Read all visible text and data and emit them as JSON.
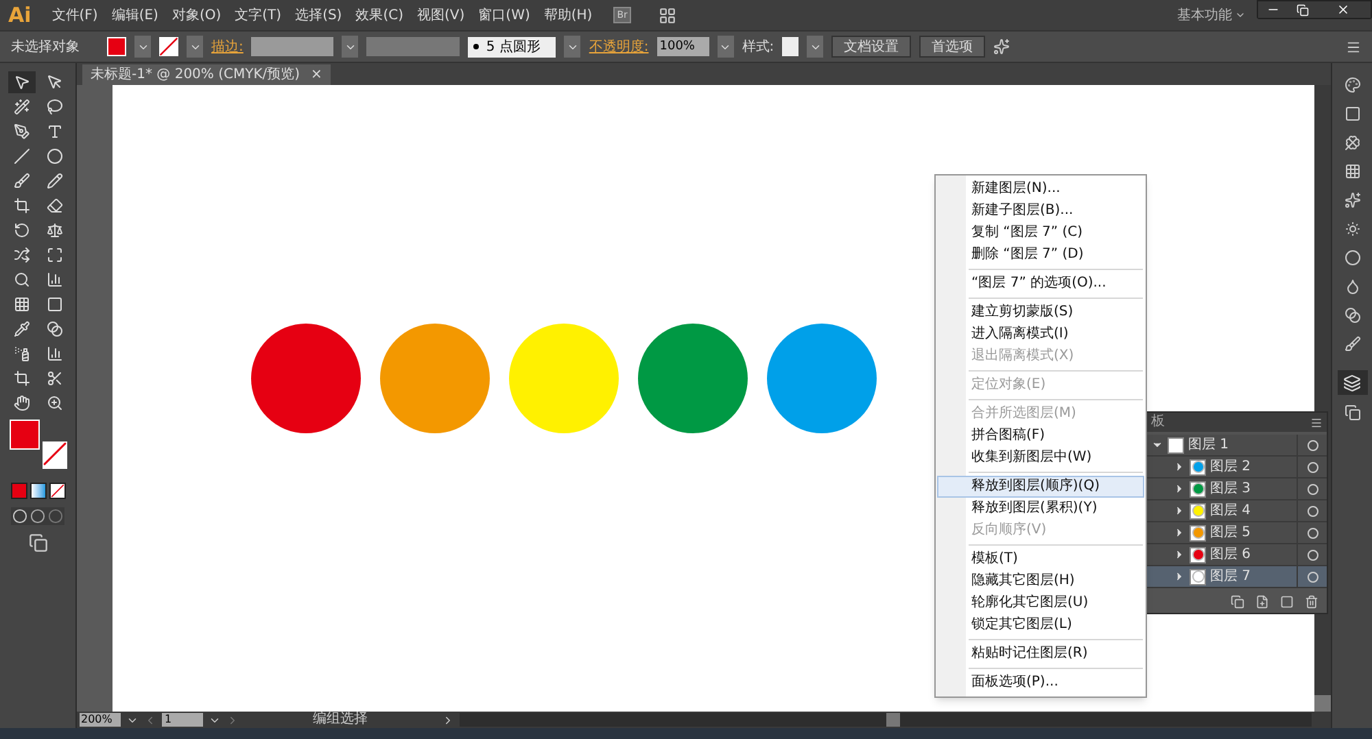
{
  "app": {
    "logo": "Ai",
    "bridge": "Br",
    "workspace": "基本功能"
  },
  "menu": [
    "文件(F)",
    "编辑(E)",
    "对象(O)",
    "文字(T)",
    "选择(S)",
    "效果(C)",
    "视图(V)",
    "窗口(W)",
    "帮助(H)"
  ],
  "control_bar": {
    "selection": "未选择对象",
    "stroke_label": "描边:",
    "brush": "5 点圆形",
    "opacity_label": "不透明度:",
    "opacity": "100%",
    "style_label": "样式:",
    "buttons": [
      "文档设置",
      "首选项"
    ]
  },
  "document_tab": {
    "title": "未标题-1* @ 200% (CMYK/预览)",
    "close": "×"
  },
  "circles": [
    {
      "color": "#e60012"
    },
    {
      "color": "#f39800"
    },
    {
      "color": "#fff100"
    },
    {
      "color": "#009944"
    },
    {
      "color": "#00a0e9"
    }
  ],
  "context_menu": {
    "sections": [
      [
        {
          "label": "新建图层(N)...",
          "disabled": false,
          "selected": false
        },
        {
          "label": "新建子图层(B)...",
          "disabled": false,
          "selected": false
        },
        {
          "label": "复制 “图层 7” (C)",
          "disabled": false,
          "selected": false
        },
        {
          "label": "删除 “图层 7” (D)",
          "disabled": false,
          "selected": false
        }
      ],
      [
        {
          "label": "“图层 7” 的选项(O)...",
          "disabled": false,
          "selected": false
        }
      ],
      [
        {
          "label": "建立剪切蒙版(S)",
          "disabled": false,
          "selected": false
        },
        {
          "label": "进入隔离模式(I)",
          "disabled": false,
          "selected": false
        },
        {
          "label": "退出隔离模式(X)",
          "disabled": true,
          "selected": false
        }
      ],
      [
        {
          "label": "定位对象(E)",
          "disabled": true,
          "selected": false
        }
      ],
      [
        {
          "label": "合并所选图层(M)",
          "disabled": true,
          "selected": false
        },
        {
          "label": "拼合图稿(F)",
          "disabled": false,
          "selected": false
        },
        {
          "label": "收集到新图层中(W)",
          "disabled": false,
          "selected": false
        }
      ],
      [
        {
          "label": "释放到图层(顺序)(Q)",
          "disabled": false,
          "selected": true
        },
        {
          "label": "释放到图层(累积)(Y)",
          "disabled": false,
          "selected": false
        },
        {
          "label": "反向顺序(V)",
          "disabled": true,
          "selected": false
        }
      ],
      [
        {
          "label": "模板(T)",
          "disabled": false,
          "selected": false
        },
        {
          "label": "隐藏其它图层(H)",
          "disabled": false,
          "selected": false
        },
        {
          "label": "轮廓化其它图层(U)",
          "disabled": false,
          "selected": false
        },
        {
          "label": "锁定其它图层(L)",
          "disabled": false,
          "selected": false
        }
      ],
      [
        {
          "label": "粘贴时记住图层(R)",
          "disabled": false,
          "selected": false
        }
      ],
      [
        {
          "label": "面板选项(P)...",
          "disabled": false,
          "selected": false
        }
      ]
    ]
  },
  "layers_panel": {
    "tab": "板",
    "layers": [
      {
        "name": "图层 1",
        "expanded": true,
        "selected": false,
        "children": [
          {
            "name": "图层 2",
            "color": "#00a0e9",
            "selected": false
          },
          {
            "name": "图层 3",
            "color": "#009944",
            "selected": false
          },
          {
            "name": "图层 4",
            "color": "#fff100",
            "selected": false
          },
          {
            "name": "图层 5",
            "color": "#f39800",
            "selected": false
          },
          {
            "name": "图层 6",
            "color": "#e60012",
            "selected": false
          },
          {
            "name": "图层 7",
            "color": "#ffffff",
            "selected": true
          }
        ]
      }
    ]
  },
  "status_bar": {
    "zoom": "200%",
    "artboard": "1",
    "tool": "编组选择"
  }
}
